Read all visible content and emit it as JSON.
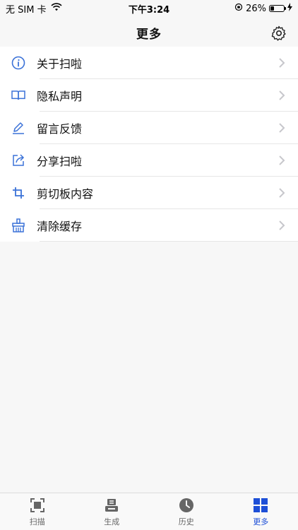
{
  "status_bar": {
    "carrier": "无 SIM 卡",
    "time": "下午3:24",
    "battery_percent": "26%",
    "battery_level": 0.26
  },
  "nav": {
    "title": "更多",
    "settings_icon": "gear-icon"
  },
  "menu": {
    "items": [
      {
        "label": "关于扫啦",
        "icon": "info-icon"
      },
      {
        "label": "隐私声明",
        "icon": "book-icon"
      },
      {
        "label": "留言反馈",
        "icon": "pencil-icon"
      },
      {
        "label": "分享扫啦",
        "icon": "share-icon"
      },
      {
        "label": "剪切板内容",
        "icon": "crop-icon"
      },
      {
        "label": "清除缓存",
        "icon": "broom-icon"
      }
    ]
  },
  "tabbar": {
    "tabs": [
      {
        "label": "扫描",
        "icon": "scan-icon",
        "active": false
      },
      {
        "label": "生成",
        "icon": "generate-icon",
        "active": false
      },
      {
        "label": "历史",
        "icon": "clock-icon",
        "active": false
      },
      {
        "label": "更多",
        "icon": "grid-icon",
        "active": true
      }
    ]
  },
  "colors": {
    "accent": "#1d4fd7",
    "icon_blue": "#3b72d8",
    "chevron": "#c7c7cc"
  }
}
